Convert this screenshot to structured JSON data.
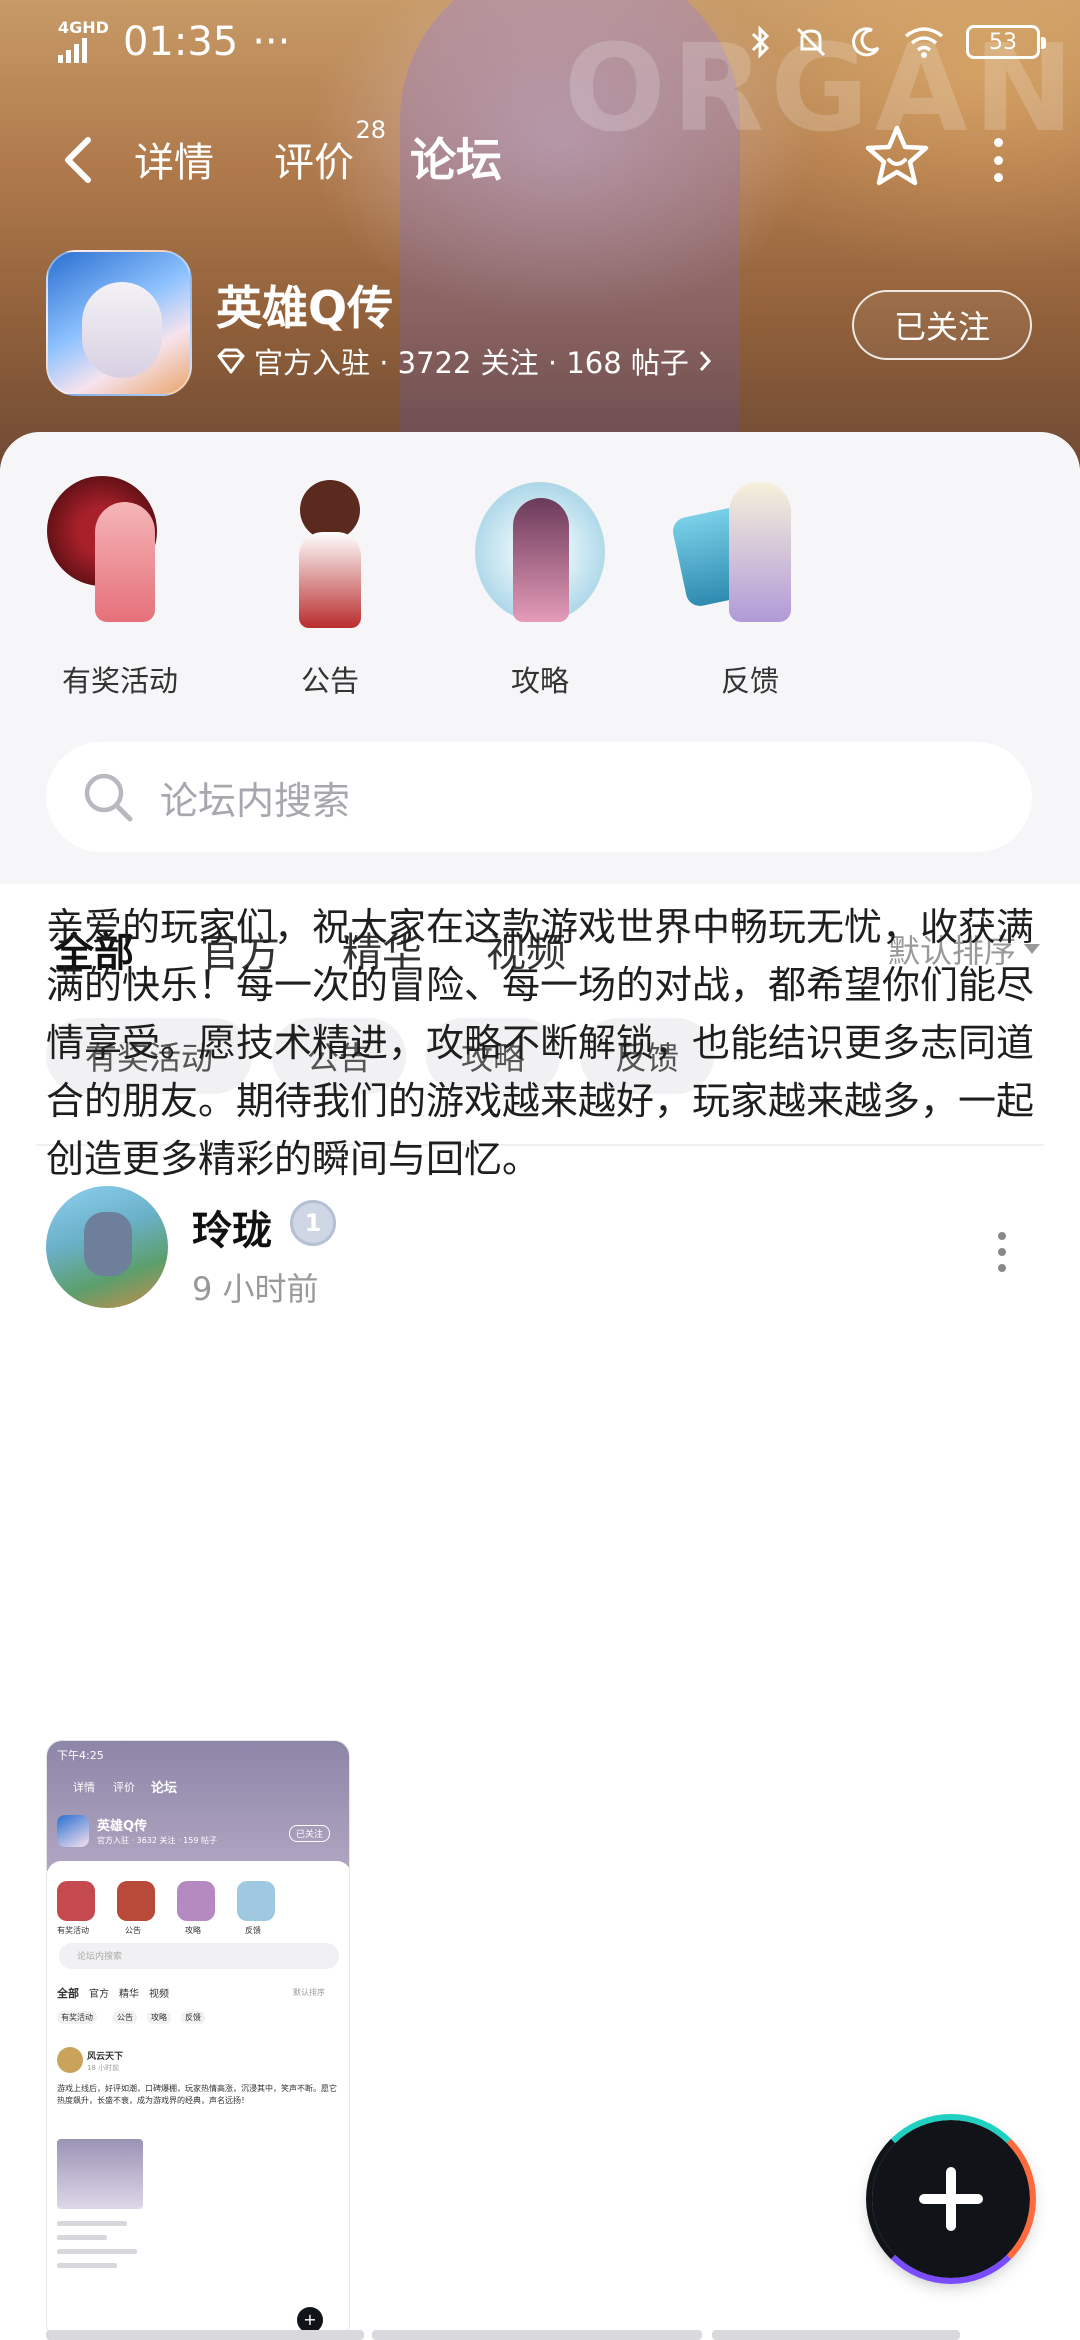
{
  "status_bar": {
    "network": "4GHD",
    "time": "01:35",
    "dots": "···",
    "battery": "53"
  },
  "header": {
    "background_word": "ORGAN",
    "tabs": [
      {
        "label": "详情"
      },
      {
        "label": "评价",
        "count": "28"
      },
      {
        "label": "论坛"
      }
    ],
    "active_tab": "论坛"
  },
  "game": {
    "title": "英雄Q传",
    "meta": "官方入驻 · 3722 关注 · 168 帖子",
    "follow_label": "已关注"
  },
  "categories": [
    {
      "label": "有奖活动"
    },
    {
      "label": "公告"
    },
    {
      "label": "攻略"
    },
    {
      "label": "反馈"
    }
  ],
  "search": {
    "placeholder": "论坛内搜索"
  },
  "filter_tabs": [
    {
      "label": "全部"
    },
    {
      "label": "官方"
    },
    {
      "label": "精华"
    },
    {
      "label": "视频"
    }
  ],
  "active_filter": "全部",
  "sort_label": "默认排序",
  "chips": [
    {
      "label": "有奖活动"
    },
    {
      "label": "公告"
    },
    {
      "label": "攻略"
    },
    {
      "label": "反馈"
    }
  ],
  "post": {
    "author": "玲珑",
    "level_badge": "1",
    "time": "9 小时前",
    "body": "亲爱的玩家们，祝大家在这款游戏世界中畅玩无忧，收获满满的快乐！每一次的冒险、每一场的对战，都希望你们能尽情享受。愿技术精进，攻略不断解锁，也能结识更多志同道合的朋友。期待我们的游戏越来越好，玩家越来越多，一起创造更多精彩的瞬间与回忆。",
    "thumbnail": {
      "status_time": "下午4:25",
      "tabs": [
        "详情",
        "评价",
        "论坛"
      ],
      "game_title": "英雄Q传",
      "game_meta": "官方入驻 · 3632 关注 · 159 帖子",
      "follow_label": "已关注",
      "categories": [
        "有奖活动",
        "公告",
        "攻略",
        "反馈"
      ],
      "search_placeholder": "论坛内搜索",
      "filter_tabs": [
        "全部",
        "官方",
        "精华",
        "视频"
      ],
      "sort_label": "默认排序",
      "chips": [
        "有奖活动",
        "公告",
        "攻略",
        "反馈"
      ],
      "post_author": "风云天下",
      "post_time": "18 小时前",
      "post_body": "游戏上线后，好评如潮，口碑爆棚，玩家热情高涨，沉浸其中，笑声不断。愿它热度飙升，长盛不衰，成为游戏界的经典，声名远扬！"
    }
  },
  "colors": {
    "accent": "#20d0c0",
    "sheet_top": "#f6f6f8",
    "chip_bg": "#f1f1f3",
    "fab_bg": "#101418"
  },
  "icons": {
    "back": "back-arrow-icon",
    "favorite": "star-face-icon",
    "more": "more-vertical-icon",
    "verified": "diamond-icon",
    "search": "search-icon",
    "create": "plus-icon"
  }
}
